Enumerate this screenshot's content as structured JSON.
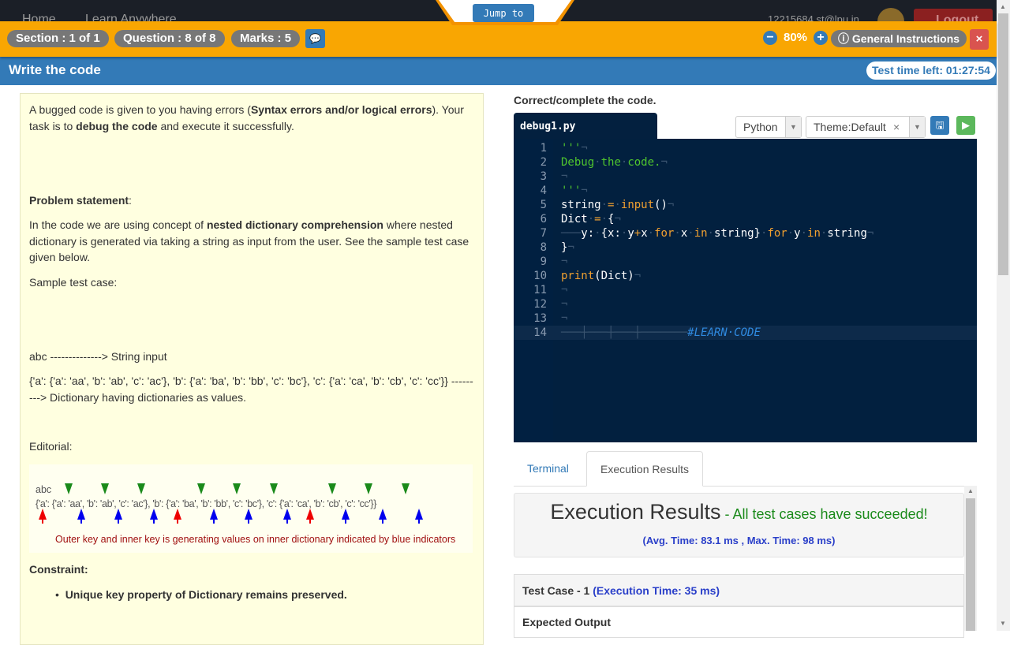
{
  "topnav": {
    "home": "Home",
    "learn": "Learn Anywhere",
    "user": "12215684.st@lpu.in",
    "logout": "Logout"
  },
  "jump_to": "Jump to",
  "status_bar": {
    "section": "Section : 1 of 1",
    "question": "Question : 8 of 8",
    "marks": "Marks : 5",
    "zoom": "80%",
    "general_instructions": "General Instructions",
    "close": "×"
  },
  "title_bar": {
    "title": "Write the code",
    "timer": "Test time left: 01:27:54"
  },
  "question": {
    "intro_1": "A bugged code is given to you having errors (",
    "intro_b1": "Syntax errors and/or logical errors",
    "intro_2": "). Your task is to ",
    "intro_b2": "debug the code",
    "intro_3": " and execute it successfully.",
    "problem_heading": "Problem statement",
    "problem_1": "In the code we are using concept of ",
    "problem_b": "nested dictionary comprehension",
    "problem_2": " where nested dictionary is generated via taking a string as input from the user. See the sample test case given below.",
    "sample_label": "Sample test case:",
    "sample_input": "abc --------------> String input",
    "sample_output": "{'a': {'a': 'aa', 'b': 'ab', 'c': 'ac'}, 'b': {'a': 'ba', 'b': 'bb', 'c': 'bc'}, 'c': {'a': 'ca', 'b': 'cb', 'c': 'cc'}} ---------> Dictionary having dictionaries as values.",
    "editorial_label": "Editorial:",
    "diagram": {
      "input": "abc",
      "output": "{'a': {'a': 'aa', 'b': 'ab', 'c': 'ac'}, 'b': {'a': 'ba', 'b': 'bb', 'c': 'bc'}, 'c': {'a': 'ca', 'b': 'cb', 'c': 'cc'}}",
      "caption": "Outer key and inner key is generating values on inner dictionary indicated by blue indicators",
      "colors": {
        "outer": "#ee0000",
        "inner": "#0000ee",
        "top": "#1a8a1a",
        "caption": "#a01010"
      }
    },
    "constraint_heading": "Constraint:",
    "constraint_item": "Unique key property of Dictionary remains preserved."
  },
  "editor": {
    "label": "Correct/complete the code.",
    "filename": "debug1.py",
    "language": "Python",
    "theme": "Theme:Default",
    "lines": [
      [
        [
          "'''",
          "k-str"
        ],
        [
          "¬",
          "k-inv"
        ]
      ],
      [
        [
          "Debug",
          "k-str"
        ],
        [
          "·",
          "k-inv"
        ],
        [
          "the",
          "k-str"
        ],
        [
          "·",
          "k-inv"
        ],
        [
          "code.",
          "k-str"
        ],
        [
          "¬",
          "k-inv"
        ]
      ],
      [
        [
          "¬",
          "k-inv"
        ]
      ],
      [
        [
          "'''",
          "k-str"
        ],
        [
          "¬",
          "k-inv"
        ]
      ],
      [
        [
          "string",
          "k-id"
        ],
        [
          "·",
          "k-inv"
        ],
        [
          "=",
          "k-op"
        ],
        [
          "·",
          "k-inv"
        ],
        [
          "input",
          "k-fn"
        ],
        [
          "()",
          "k-id"
        ],
        [
          "¬",
          "k-inv"
        ]
      ],
      [
        [
          "Dict",
          "k-id"
        ],
        [
          "·",
          "k-inv"
        ],
        [
          "=",
          "k-op"
        ],
        [
          "·",
          "k-inv"
        ],
        [
          "{",
          "k-id"
        ],
        [
          "¬",
          "k-inv"
        ]
      ],
      [
        [
          "───",
          "k-inv"
        ],
        [
          "y:",
          "k-id"
        ],
        [
          "·",
          "k-inv"
        ],
        [
          "{x:",
          "k-id"
        ],
        [
          "·",
          "k-inv"
        ],
        [
          "y",
          "k-id"
        ],
        [
          "+",
          "k-op"
        ],
        [
          "x",
          "k-id"
        ],
        [
          "·",
          "k-inv"
        ],
        [
          "for",
          "k-kw"
        ],
        [
          "·",
          "k-inv"
        ],
        [
          "x",
          "k-id"
        ],
        [
          "·",
          "k-inv"
        ],
        [
          "in",
          "k-kw"
        ],
        [
          "·",
          "k-inv"
        ],
        [
          "string}",
          "k-id"
        ],
        [
          "·",
          "k-inv"
        ],
        [
          "for",
          "k-kw"
        ],
        [
          "·",
          "k-inv"
        ],
        [
          "y",
          "k-id"
        ],
        [
          "·",
          "k-inv"
        ],
        [
          "in",
          "k-kw"
        ],
        [
          "·",
          "k-inv"
        ],
        [
          "string",
          "k-id"
        ],
        [
          "¬",
          "k-inv"
        ]
      ],
      [
        [
          "}",
          "k-id"
        ],
        [
          "¬",
          "k-inv"
        ]
      ],
      [
        [
          "¬",
          "k-inv"
        ]
      ],
      [
        [
          "print",
          "k-fn"
        ],
        [
          "(Dict)",
          "k-id"
        ],
        [
          "¬",
          "k-inv"
        ]
      ],
      [
        [
          "¬",
          "k-inv"
        ]
      ],
      [
        [
          "¬",
          "k-inv"
        ]
      ],
      [
        [
          "¬",
          "k-inv"
        ]
      ],
      [
        [
          "───┼───┼───┼───────",
          "k-inv"
        ],
        [
          "#LEARN·CODE",
          "k-cm"
        ]
      ]
    ]
  },
  "results": {
    "tabs": [
      "Terminal",
      "Execution Results"
    ],
    "heading": "Execution Results",
    "status": " - All test cases have succeeded!",
    "timing": "(Avg. Time: 83.1 ms , Max. Time: 98 ms)",
    "test_case": "Test Case - 1",
    "test_case_time": "(Execution Time: 35 ms)",
    "expected_output": "Expected Output"
  }
}
